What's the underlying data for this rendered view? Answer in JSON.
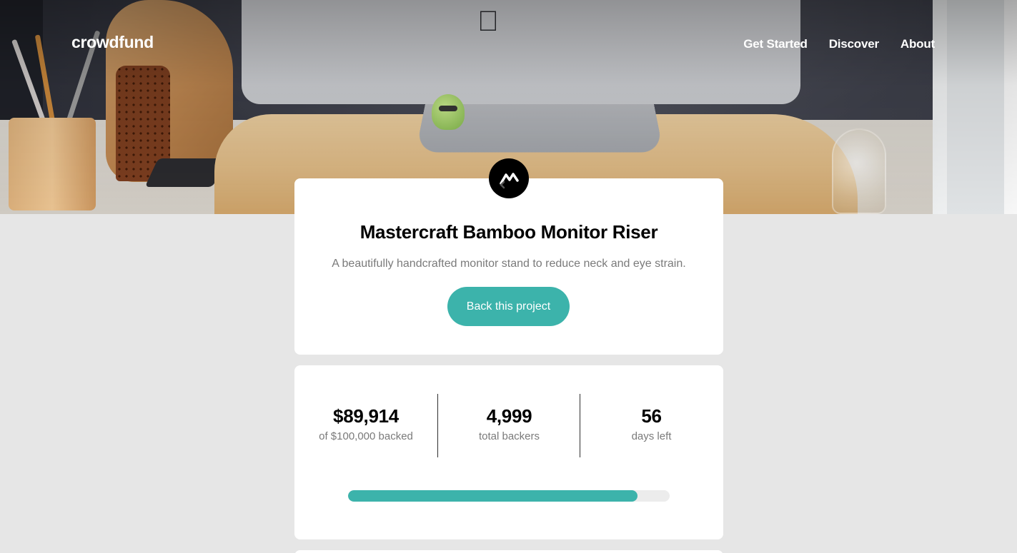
{
  "header": {
    "logo": "crowdfund",
    "nav": [
      {
        "label": "Get Started"
      },
      {
        "label": "Discover"
      },
      {
        "label": "About"
      }
    ]
  },
  "project": {
    "badge_icon": "mastercraft-logo-icon",
    "title": "Mastercraft Bamboo Monitor Riser",
    "description": "A beautifully handcrafted monitor stand to reduce neck and eye strain.",
    "back_button_label": "Back this project"
  },
  "stats": {
    "backed": {
      "value": "$89,914",
      "label": "of $100,000 backed"
    },
    "backers": {
      "value": "4,999",
      "label": "total backers"
    },
    "days": {
      "value": "56",
      "label": "days left"
    },
    "progress_fraction": 0.89914
  },
  "colors": {
    "accent": "#3cb3ab",
    "background": "#e6e6e6",
    "card": "#ffffff",
    "text_primary": "#000000",
    "text_secondary": "#7a7a7a"
  }
}
